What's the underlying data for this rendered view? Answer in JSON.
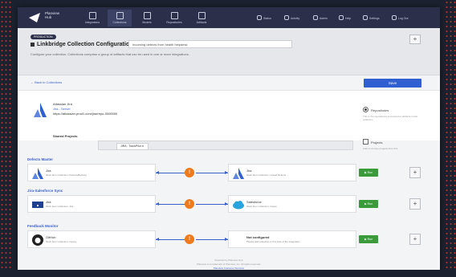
{
  "app": {
    "name_line1": "Planview",
    "name_line2": "Hub"
  },
  "nav": {
    "tabs": [
      {
        "label": "Integrations",
        "active": false
      },
      {
        "label": "Collections",
        "active": true
      },
      {
        "label": "Models",
        "active": false
      },
      {
        "label": "Repositories",
        "active": false
      },
      {
        "label": "Artifacts",
        "active": false
      }
    ],
    "right_items": [
      "Status",
      "Activity",
      "Admin",
      "Help",
      "Settings",
      "Log Out"
    ]
  },
  "header": {
    "badge": "PRODUCTION",
    "title": "Linkbridge Collection Configuration",
    "description_value": "Incoming defects from health helpdesk",
    "subtext": "Configure your collection. Collections comprise a group of artifacts that can be used in one or more integrations.",
    "plus": "+"
  },
  "back": {
    "label": "← Back to Collections",
    "save_label": "Save"
  },
  "repository": {
    "name": "Atlassian Jira",
    "type": "Jira - Server",
    "url": "https://atlassian.prod1.com/jira/repo-0000000"
  },
  "options": {
    "repositories_label": "Repositories",
    "repositories_desc": "This is the repositories connected to artifacts in this collection",
    "projects_label": "Projects",
    "projects_desc": "Add or remove projects from this"
  },
  "shared_projects": {
    "label": "Shared Projects",
    "selected": "JIRA : TrackPilot ✕"
  },
  "sections": [
    {
      "title": "Defects Master",
      "left_name": "Jira",
      "left_desc": "Work Item Collection: Defects/Backlog",
      "right_name": "Jira",
      "right_desc": "Work Item Collection: Linked Defects",
      "badge": "!",
      "run": "▶ Run",
      "more": "+"
    },
    {
      "title": "Jira-Salesforce Sync",
      "left_name": "Jira",
      "left_desc": "Work Item Collection: Jira",
      "right_name": "Salesforce",
      "right_desc": "Work Item Collection: Cases",
      "badge": "!",
      "run": "▶ Run",
      "more": "+"
    },
    {
      "title": "Feedback Monitor",
      "left_name": "GitHub",
      "left_desc": "Work Item Collection: Issues",
      "right_name": "Not configured",
      "right_desc": "Please add collection to this side of the integration",
      "badge": "!",
      "run": "▶ Run",
      "more": "+"
    }
  ],
  "footer": {
    "line1": "Powered by Planview Hub",
    "line2": "Planview is a trademark of Planview, Inc. All rights reserved.",
    "link": "Planview Customer Success"
  },
  "colors": {
    "nav": "#2b2f4a",
    "accent": "#2f5fd0",
    "run": "#3a9b3a",
    "badge": "#ee7a1b"
  }
}
